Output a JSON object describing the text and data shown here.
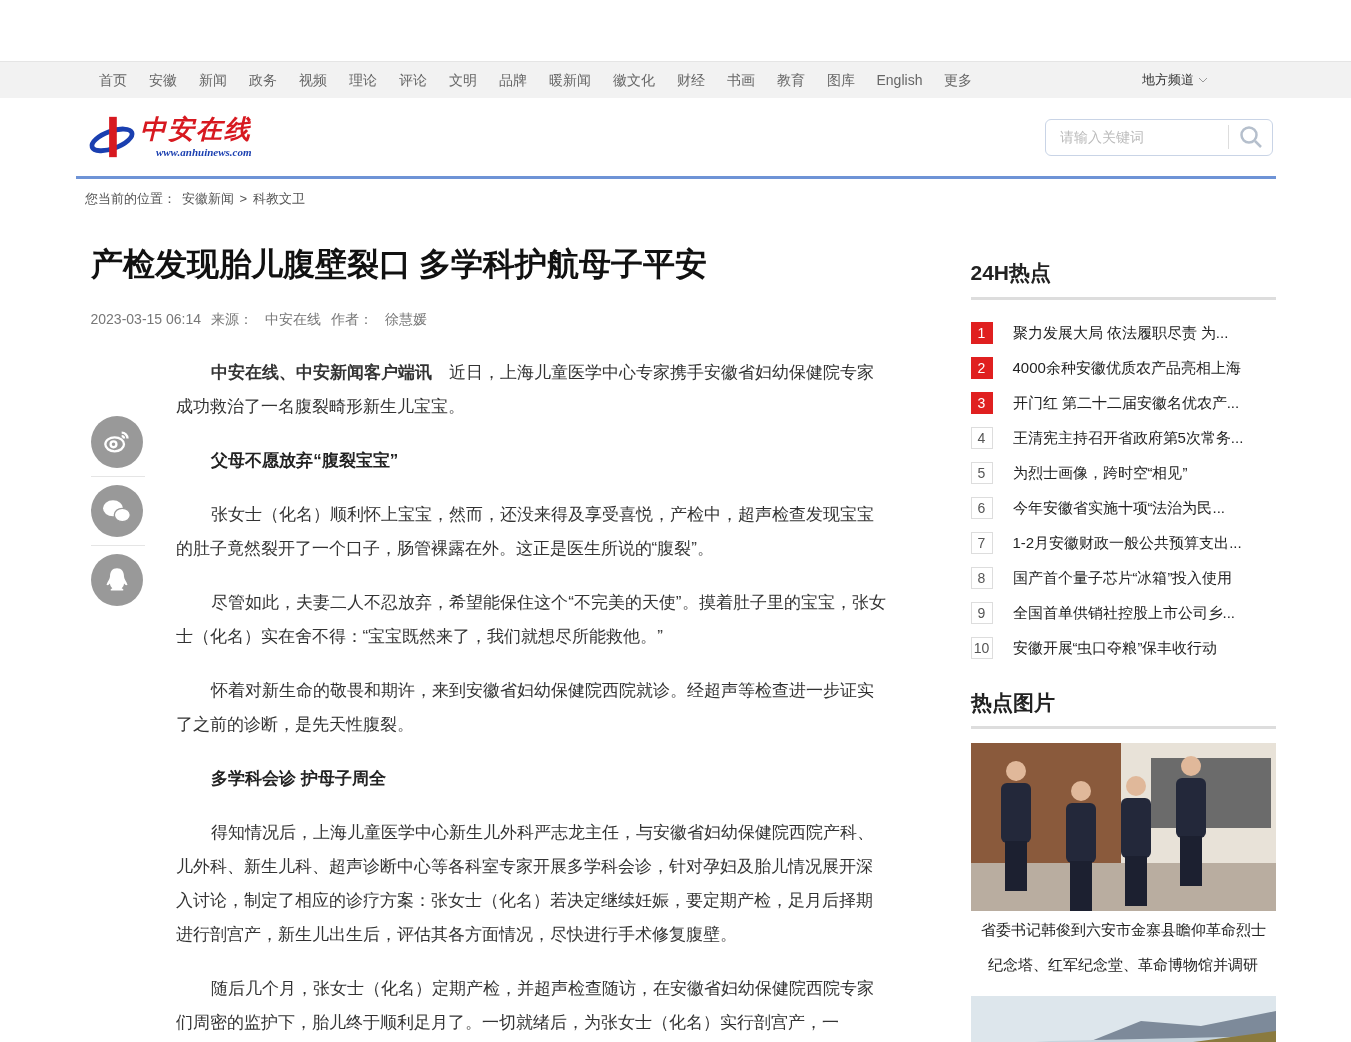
{
  "nav": {
    "items": [
      "首页",
      "安徽",
      "新闻",
      "政务",
      "视频",
      "理论",
      "评论",
      "文明",
      "品牌",
      "暖新闻",
      "徽文化",
      "财经",
      "书画",
      "教育",
      "图库",
      "English",
      "更多"
    ],
    "local": "地方频道"
  },
  "header": {
    "logo_text": "中安在线",
    "logo_url": "www.anhuinews.com",
    "search": {
      "placeholder": "请输入关键词"
    }
  },
  "breadcrumb": {
    "label": "您当前的位置：",
    "links": [
      "安徽新闻",
      "科教文卫"
    ],
    "separator": ">"
  },
  "article": {
    "title": "产检发现胎儿腹壁裂口 多学科护航母子平安",
    "date": "2023-03-15 06:14",
    "source_label": "来源：",
    "source": "中安在线",
    "author_label": "作者：",
    "author": "徐慧媛",
    "paragraphs": [
      {
        "kind": "text",
        "text": "**中安在线、中安新闻客户端讯**　近日，上海儿童医学中心专家携手安徽省妇幼保健院专家成功救治了一名腹裂畸形新生儿宝宝。"
      },
      {
        "kind": "heading",
        "text": "父母不愿放弃“腹裂宝宝”"
      },
      {
        "kind": "text",
        "text": "张女士（化名）顺利怀上宝宝，然而，还没来得及享受喜悦，产检中，超声检查发现宝宝的肚子竟然裂开了一个口子，肠管裸露在外。这正是医生所说的“腹裂”。"
      },
      {
        "kind": "text",
        "text": "尽管如此，夫妻二人不忍放弃，希望能保住这个“不完美的天使”。摸着肚子里的宝宝，张女士（化名）实在舍不得：“宝宝既然来了，我们就想尽所能救他。”"
      },
      {
        "kind": "text",
        "text": "怀着对新生命的敬畏和期许，来到安徽省妇幼保健院西院就诊。经超声等检查进一步证实了之前的诊断，是先天性腹裂。"
      },
      {
        "kind": "heading",
        "text": "多学科会诊 护母子周全"
      },
      {
        "kind": "text",
        "text": "得知情况后，上海儿童医学中心新生儿外科严志龙主任，与安徽省妇幼保健院西院产科、儿外科、新生儿科、超声诊断中心等各科室专家开展多学科会诊，针对孕妇及胎儿情况展开深入讨论，制定了相应的诊疗方案：张女士（化名）若决定继续妊娠，要定期产检，足月后择期进行剖宫产，新生儿出生后，评估其各方面情况，尽快进行手术修复腹壁。"
      },
      {
        "kind": "text",
        "text": "随后几个月，张女士（化名）定期产检，并超声检查随访，在安徽省妇幼保健院西院专家们周密的监护下，胎儿终于顺利足月了。一切就绪后，为张女士（化名）实行剖宫产，一"
      }
    ]
  },
  "share": [
    {
      "kind": "weibo"
    },
    {
      "kind": "wechat"
    },
    {
      "kind": "qq"
    }
  ],
  "hot24": {
    "title": "24H热点",
    "items": [
      {
        "rank": "1",
        "top": true,
        "text": "聚力发展大局 依法履职尽责 为..."
      },
      {
        "rank": "2",
        "top": true,
        "text": "4000余种安徽优质农产品亮相上海"
      },
      {
        "rank": "3",
        "top": true,
        "text": "开门红 第二十二届安徽名优农产..."
      },
      {
        "rank": "4",
        "top": false,
        "text": "王清宪主持召开省政府第5次常务..."
      },
      {
        "rank": "5",
        "top": false,
        "text": "为烈士画像，跨时空“相见”"
      },
      {
        "rank": "6",
        "top": false,
        "text": "今年安徽省实施十项“法治为民..."
      },
      {
        "rank": "7",
        "top": false,
        "text": "1-2月安徽财政一般公共预算支出..."
      },
      {
        "rank": "8",
        "top": false,
        "text": "国产首个量子芯片“冰箱”投入使用"
      },
      {
        "rank": "9",
        "top": false,
        "text": "全国首单供销社控股上市公司乡..."
      },
      {
        "rank": "10",
        "top": false,
        "text": "安徽开展“虫口夺粮”保丰收行动"
      }
    ]
  },
  "hot_pictures": {
    "title": "热点图片",
    "items": [
      {
        "kind": "people",
        "caption": "省委书记韩俊到六安市金寨县瞻仰革命烈士纪念塔、红军纪念堂、革命博物馆并调研"
      },
      {
        "kind": "landscape"
      }
    ]
  }
}
